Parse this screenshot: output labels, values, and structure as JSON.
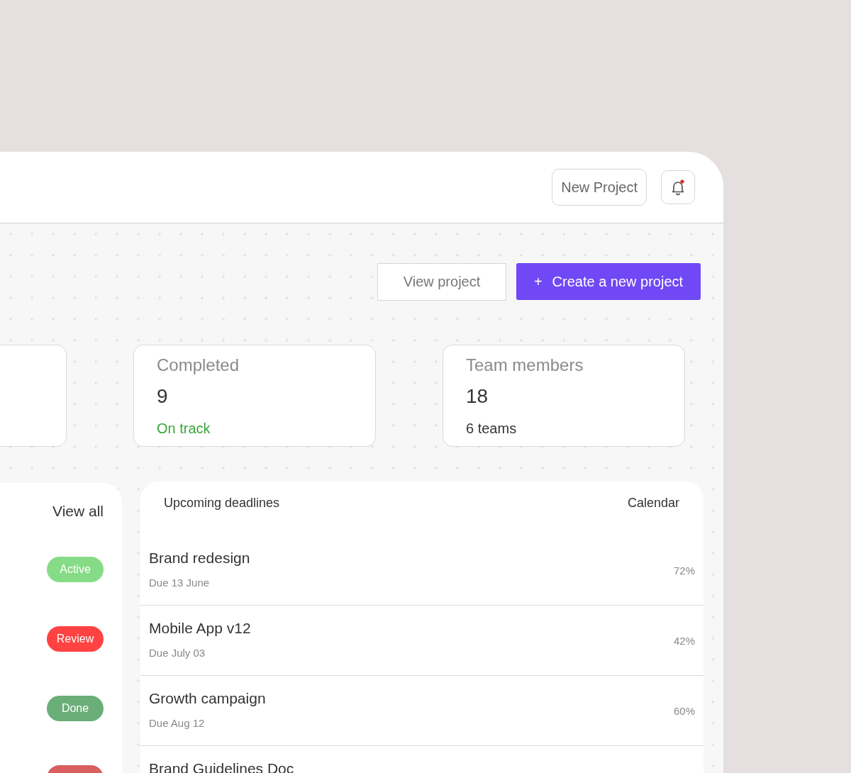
{
  "header": {
    "new_project_button": "New Project",
    "notifications": {
      "unread": true
    }
  },
  "actions": {
    "view_project": "View project",
    "create_icon": "+",
    "create_project": "Create a new project"
  },
  "stats": [
    {
      "kind": "clipped"
    },
    {
      "kind": "full",
      "label": "Completed",
      "value": "9",
      "note": "On track",
      "positive": true
    },
    {
      "kind": "full",
      "label": "Team members",
      "value": "18",
      "note": "6 teams",
      "positive": false
    }
  ],
  "status_panel": {
    "link": "View all",
    "statuses": [
      {
        "label": "Active",
        "color": "#86dc86"
      },
      {
        "label": "Review",
        "color": "#ff4242"
      },
      {
        "label": "Done",
        "color": "#6aae78"
      },
      {
        "color": "#d95f5f"
      }
    ]
  },
  "deadlines": {
    "title": "Upcoming deadlines",
    "link": "Calendar",
    "items": [
      {
        "name": "Brand redesign",
        "due": "Due 13 June",
        "percent": "72%"
      },
      {
        "name": "Mobile App v12",
        "due": "Due July 03",
        "percent": "42%"
      },
      {
        "name": "Growth campaign",
        "due": "Due Aug 12",
        "percent": "60%"
      },
      {
        "name": "Brand Guidelines Doc"
      }
    ]
  }
}
